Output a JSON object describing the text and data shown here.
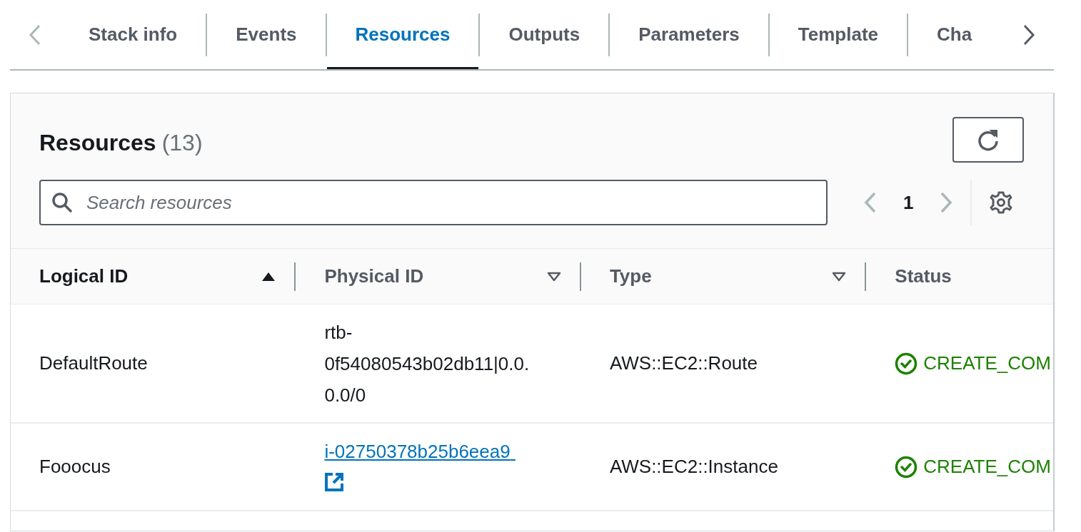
{
  "tabs": [
    {
      "label": "Stack info",
      "selected": false
    },
    {
      "label": "Events",
      "selected": false
    },
    {
      "label": "Resources",
      "selected": true
    },
    {
      "label": "Outputs",
      "selected": false
    },
    {
      "label": "Parameters",
      "selected": false
    },
    {
      "label": "Template",
      "selected": false
    },
    {
      "label": "Cha",
      "selected": false
    }
  ],
  "panel": {
    "title": "Resources",
    "count": "(13)",
    "search": {
      "placeholder": "Search resources"
    },
    "page": "1"
  },
  "table": {
    "columns": [
      {
        "label": "Logical ID",
        "kind": "sorted"
      },
      {
        "label": "Physical ID",
        "kind": "sortable"
      },
      {
        "label": "Type",
        "kind": "sortable"
      },
      {
        "label": "Status",
        "kind": "plain"
      }
    ],
    "rows": [
      {
        "logical_id": "DefaultRoute",
        "physical_id": {
          "text": "rtb-0f54080543b02db11|0.0.0.0/0",
          "link": false
        },
        "type": "AWS::EC2::Route",
        "status": "CREATE_COM"
      },
      {
        "logical_id": "Fooocus",
        "physical_id": {
          "text": "i-02750378b25b6eea9",
          "link": true
        },
        "type": "AWS::EC2::Instance",
        "status": "CREATE_COM"
      }
    ]
  }
}
